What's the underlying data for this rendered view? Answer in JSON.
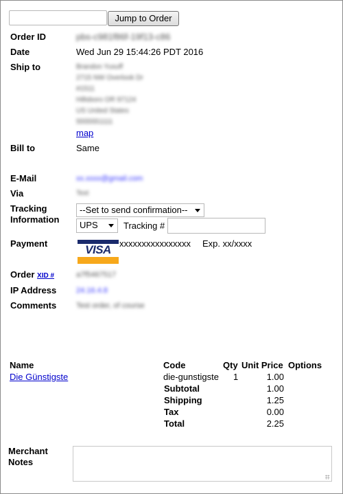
{
  "jump": {
    "input_value": "",
    "button_label": "Jump to Order"
  },
  "order": {
    "id_label": "Order ID",
    "id_value": "pbs-c981f86f-19f13-c86",
    "date_label": "Date",
    "date_value": "Wed Jun 29 15:44:26 PDT 2016",
    "ship_label": "Ship to",
    "ship_lines": [
      "Brandon Yusuff",
      "2715 NW Overlook Dr",
      "#1511",
      "Hillsboro OR 97124",
      "US United States",
      "5555551111"
    ],
    "map_link": "map",
    "bill_label": "Bill to",
    "bill_value": "Same",
    "email_label": "E-Mail",
    "email_value": "xx.xxxx@gmail.com",
    "via_label": "Via",
    "via_value": "Text",
    "tracking_label_1": "Tracking",
    "tracking_label_2": "Information",
    "confirmation_select": "--Set to send confirmation--",
    "carrier_select": "UPS",
    "tracking_num_label": "Tracking #",
    "tracking_num_value": "",
    "payment_label": "Payment",
    "card_brand": "VISA",
    "card_number": "xxxxxxxxxxxxxxxx",
    "card_exp": "Exp. xx/xxxx",
    "order_label": "Order",
    "xid_link": "XID #",
    "xid_value": "a7f5467517",
    "ip_label": "IP Address",
    "ip_value": "24.16.4.8",
    "comments_label": "Comments",
    "comments_value": "Test order, of course"
  },
  "items": {
    "headers": {
      "name": "Name",
      "code": "Code",
      "qty": "Qty",
      "unit_price": "Unit Price",
      "options": "Options"
    },
    "rows": [
      {
        "name": "Die Günstigste",
        "code": "die-gunstigste",
        "qty": "1",
        "unit_price": "1.00",
        "options": ""
      }
    ],
    "totals": [
      {
        "label": "Subtotal",
        "value": "1.00"
      },
      {
        "label": "Shipping",
        "value": "1.25"
      },
      {
        "label": "Tax",
        "value": "0.00"
      },
      {
        "label": "Total",
        "value": "2.25"
      }
    ]
  },
  "notes": {
    "label_1": "Merchant",
    "label_2": "Notes",
    "value": ""
  },
  "colors": {
    "link": "#0000cc",
    "visa_blue": "#1a2a6c",
    "visa_gold": "#f7a81b"
  }
}
